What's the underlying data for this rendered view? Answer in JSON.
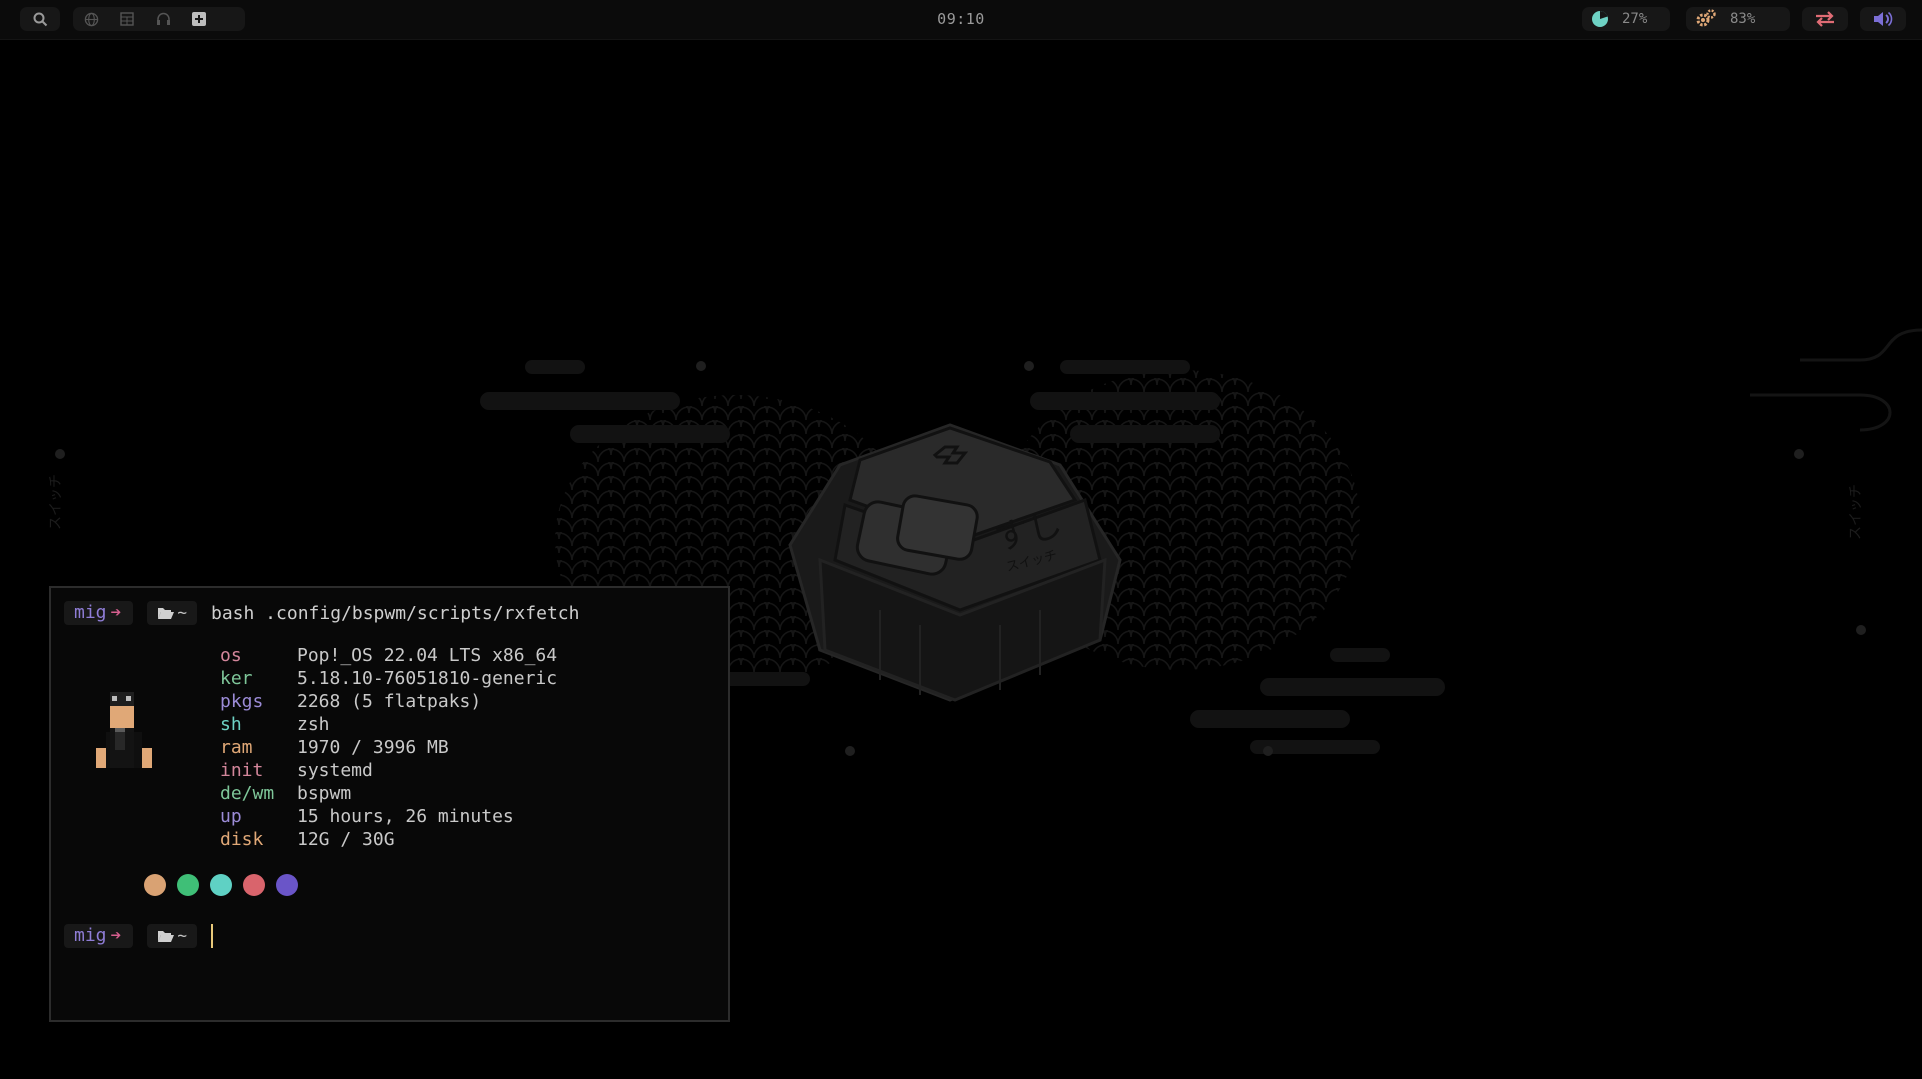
{
  "topbar": {
    "clock": "09:10",
    "left_icons": [
      "search-icon",
      "globe-icon",
      "grid-icon",
      "headphones-icon",
      "plus-square-icon"
    ],
    "cpu_percent": "27%",
    "ram_percent": "83%",
    "colors": {
      "cpu": "#6ed2c4",
      "ram": "#e0a877",
      "net": "#e06c75",
      "vol": "#7c6fd6"
    }
  },
  "terminal": {
    "user": "mig",
    "arrow": "➔",
    "dir": "~",
    "command": "bash .config/bspwm/scripts/rxfetch",
    "info": [
      {
        "key": "os",
        "value": "Pop!_OS 22.04 LTS x86_64",
        "color": "#d3869b"
      },
      {
        "key": "ker",
        "value": "5.18.10-76051810-generic",
        "color": "#7ec699"
      },
      {
        "key": "pkgs",
        "value": "2268 (5 flatpaks)",
        "color": "#9b8bd6"
      },
      {
        "key": "sh",
        "value": "zsh",
        "color": "#6ed2c4"
      },
      {
        "key": "ram",
        "value": "1970 / 3996 MB",
        "color": "#e0a877"
      },
      {
        "key": "init",
        "value": "systemd",
        "color": "#d3869b"
      },
      {
        "key": "de/wm",
        "value": "bspwm",
        "color": "#7ec699"
      },
      {
        "key": "up",
        "value": "15 hours, 26 minutes",
        "color": "#9b8bd6"
      },
      {
        "key": "disk",
        "value": "12G / 30G",
        "color": "#e0a877"
      }
    ],
    "swatches": [
      "#d9a273",
      "#3fbf77",
      "#5fd1c4",
      "#d9646c",
      "#6a55c8"
    ]
  },
  "wallpaper": {
    "keycap_text": "すし",
    "keycap_subtext": "スイッチ"
  }
}
